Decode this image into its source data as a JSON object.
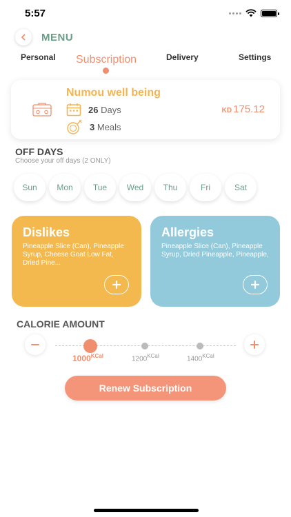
{
  "status_bar": {
    "time": "5:57"
  },
  "header": {
    "title": "MENU"
  },
  "tabs": [
    {
      "label": "Personal",
      "active": false
    },
    {
      "label": "Subscription",
      "active": true
    },
    {
      "label": "Delivery",
      "active": false
    },
    {
      "label": "Settings",
      "active": false
    }
  ],
  "subscription": {
    "name": "Numou well being",
    "days_count": "26",
    "days_label": "Days",
    "meals_count": "3",
    "meals_label": "Meals",
    "currency": "KD",
    "price": "175.12"
  },
  "off_days": {
    "title": "OFF DAYS",
    "subtitle": "Choose your off days (2 ONLY)",
    "days": [
      "Sun",
      "Mon",
      "Tue",
      "Wed",
      "Thu",
      "Fri",
      "Sat"
    ]
  },
  "dislikes": {
    "title": "Dislikes",
    "text": "Pineapple Slice (Can), Pineapple Syrup, Cheese Goat Low Fat, Dried Pine..."
  },
  "allergies": {
    "title": "Allergies",
    "text": "Pineapple Slice (Can), Pineapple Syrup, Dried Pineapple, Pineapple,"
  },
  "calorie": {
    "title": "CALORIE AMOUNT",
    "unit": "KCal",
    "options": [
      "1000",
      "1200",
      "1400"
    ],
    "selected": "1000"
  },
  "renew_button": "Renew Subscription",
  "colors": {
    "accent": "#f08f6e",
    "green": "#6a9d87",
    "yellow": "#f3b94e",
    "blue": "#92cadc"
  }
}
